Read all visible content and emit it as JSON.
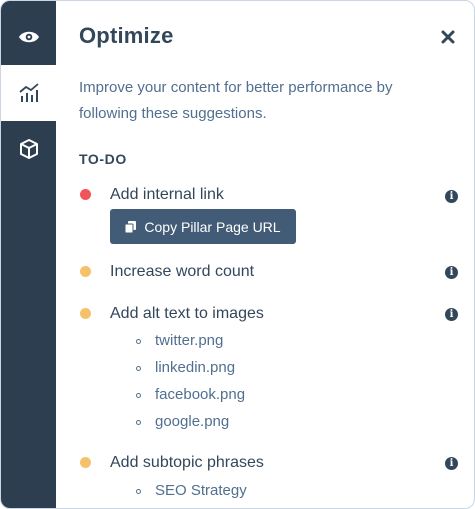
{
  "rail": {
    "tabs": [
      {
        "icon": "eye-icon",
        "active": false
      },
      {
        "icon": "analytics-icon",
        "active": true
      },
      {
        "icon": "cube-icon",
        "active": false
      }
    ]
  },
  "header": {
    "title": "Optimize",
    "close_icon": "close-icon"
  },
  "description": "Improve your content for better performance by following these suggestions.",
  "section_label": "TO-DO",
  "colors": {
    "red": "#f2545b",
    "yellow": "#f5c26b",
    "rail": "#2d3e50",
    "button": "#425b76"
  },
  "todos": [
    {
      "title": "Add internal link",
      "status": "red",
      "button_label": "Copy Pillar Page URL"
    },
    {
      "title": "Increase word count",
      "status": "yellow"
    },
    {
      "title": "Add alt text to images",
      "status": "yellow",
      "items": [
        "twitter.png",
        "linkedin.png",
        "facebook.png",
        "google.png"
      ]
    },
    {
      "title": "Add subtopic phrases",
      "status": "yellow",
      "items": [
        "SEO Strategy"
      ]
    }
  ]
}
